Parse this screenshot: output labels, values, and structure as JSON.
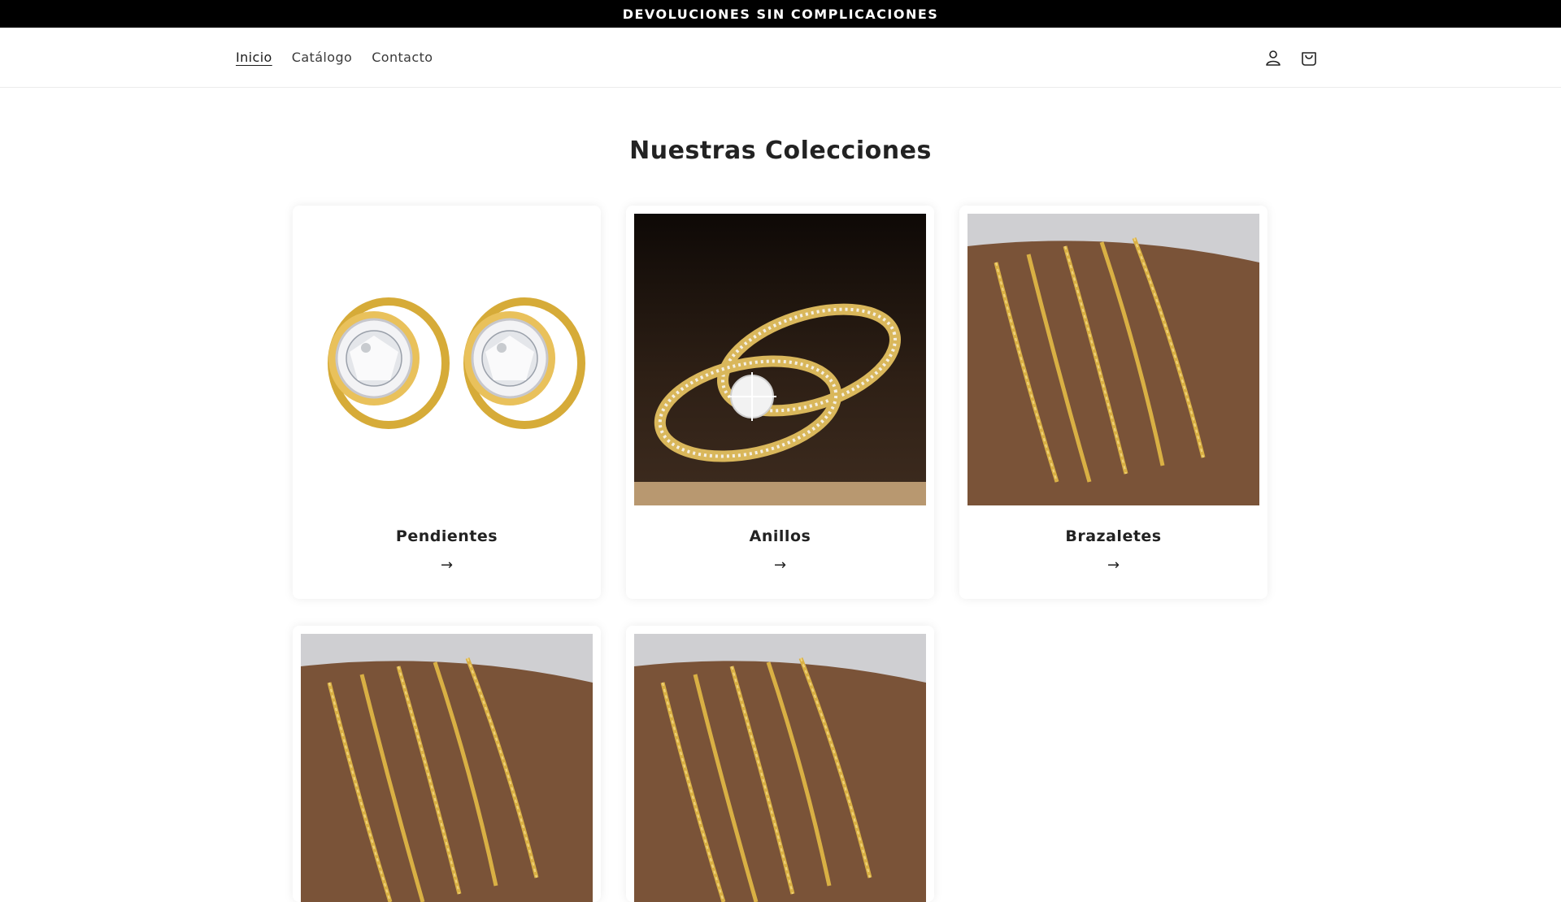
{
  "announcement": "DEVOLUCIONES SIN COMPLICACIONES",
  "nav": {
    "items": [
      {
        "label": "Inicio",
        "active": true
      },
      {
        "label": "Catálogo",
        "active": false
      },
      {
        "label": "Contacto",
        "active": false
      }
    ]
  },
  "header_icons": [
    "account-icon",
    "cart-icon"
  ],
  "section": {
    "title": "Nuestras Colecciones"
  },
  "collections": [
    {
      "name": "Pendientes",
      "arrow": "→",
      "image": "earrings-image"
    },
    {
      "name": "Anillos",
      "arrow": "→",
      "image": "rings-image"
    },
    {
      "name": "Brazaletes",
      "arrow": "→",
      "image": "bracelets-image"
    },
    {
      "name": "",
      "arrow": "",
      "image": "bracelets-image"
    },
    {
      "name": "",
      "arrow": "",
      "image": "bracelets-image"
    }
  ],
  "colors": {
    "gold": "#d4a93a",
    "dark": "#1a1a1a",
    "announcement_bg": "#000000"
  }
}
